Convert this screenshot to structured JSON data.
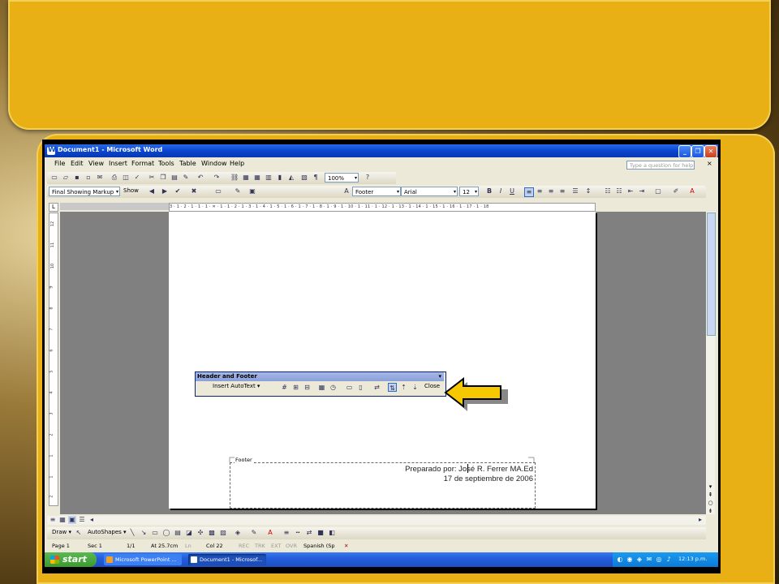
{
  "window": {
    "title": "Document1 - Microsoft Word",
    "minimize": "_",
    "restore": "❐",
    "close": "✕"
  },
  "menu": {
    "items": [
      "File",
      "Edit",
      "View",
      "Insert",
      "Format",
      "Tools",
      "Table",
      "Window",
      "Help"
    ],
    "help_placeholder": "Type a question for help",
    "doc_close": "×"
  },
  "standard_toolbar": {
    "zoom": "100%"
  },
  "formatting_toolbar": {
    "markup_mode": "Final Showing Markup",
    "show_label": "Show",
    "style": "Footer",
    "font": "Arial",
    "size": "12",
    "bold": "B",
    "italic": "I",
    "underline": "U"
  },
  "ruler": {
    "marks": "3 · 1 · 2 · 1 · 1 · 1 · ✕ · 1 · 1 · 2 · 1 · 3 · 1 · 4 · 1 · 5 · 1 · 6 · 1 · 7 · 1 · 8 · 1 · 9 · 1 · 10 · 1 · 11 · 1 · 12 · 1 · 13 · 1 · 14 · 1 · 15 · 1 · 16 · 1 · 17 · 1 · 18",
    "tab_selector": "L"
  },
  "vruler_marks": [
    "12",
    "11",
    "10",
    "9",
    "8",
    "7",
    "6",
    "5",
    "4",
    "3",
    "2",
    "1",
    "1",
    "2"
  ],
  "header_footer_toolbar": {
    "title": "Header and Footer",
    "insert_autotext": "Insert AutoText ▾",
    "close": "Close"
  },
  "footer": {
    "label": "Footer",
    "line1": "Preparado por: José R. Ferrer MA.Ed",
    "line2": "17 de septiembre de 2006"
  },
  "draw_toolbar": {
    "draw": "Draw ▾",
    "autoshapes": "AutoShapes ▾"
  },
  "status": {
    "page": "Page 1",
    "sec": "Sec 1",
    "pages": "1/1",
    "at": "At 25.7cm",
    "ln": "Ln",
    "col": "Col 22",
    "rec": "REC",
    "trk": "TRK",
    "ext": "EXT",
    "ovr": "OVR",
    "language": "Spanish (Sp"
  },
  "taskbar": {
    "start": "start",
    "tasks": [
      "Microsoft PowerPoint ...",
      "Document1 - Microsof..."
    ],
    "clock": "12:13 p.m."
  },
  "colors": {
    "slide_gold": "#e8b014",
    "arrow_fill": "#f5c800",
    "titlebar_blue": "#0a46d0"
  }
}
